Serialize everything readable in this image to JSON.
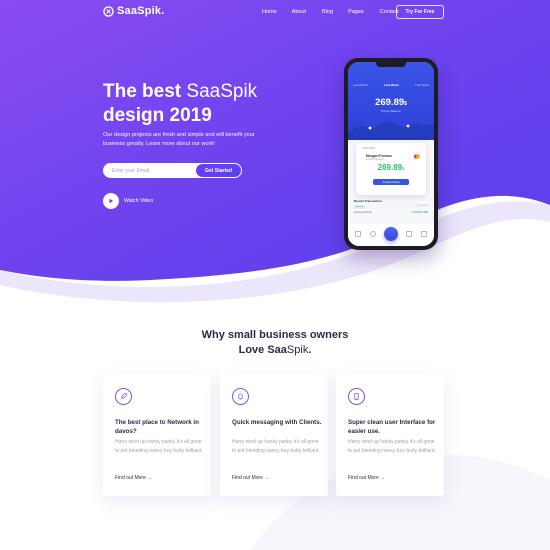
{
  "brand": {
    "logo_text": "SaaSpik.",
    "accent": "#6a3df0"
  },
  "nav": {
    "links": [
      "Home",
      "About",
      "Blog",
      "Pages",
      "Contact"
    ],
    "cta": "Try For Free"
  },
  "hero": {
    "headline_bold_1": "The best",
    "headline_light": " SaaSpik",
    "headline_bold_2": "design 2019",
    "subtext": "Our design projects are fresh and simple and will benefit your business greatly. Learn more about our work!",
    "email_placeholder": "Enter your Email",
    "cta": "Get Started",
    "watch_label": "Watch Video"
  },
  "phone": {
    "tabs": [
      "Last Month",
      "Last Week",
      "This Week"
    ],
    "amount": "269.89",
    "currency": "$",
    "amount_sub": "Payout Balance",
    "card": {
      "date": "24.03.2019",
      "name": "Morgan Freeman",
      "email": "[email protected]",
      "amount": "269.89",
      "currency": "$",
      "button": "Accept Invoice"
    },
    "recent_title": "Recent Transaction",
    "transaction": {
      "badge": "Success",
      "date": "24.03.2019",
      "email": "[email protected]",
      "amount": "+ $ 67.65 USD"
    }
  },
  "section": {
    "title_line1": "Why small business owners",
    "title_line2_bold": "Love Saa",
    "title_line2_light": "Spik",
    "title_line2_end": "."
  },
  "features": [
    {
      "icon": "rocket-icon",
      "title": "The best place to Network in davos?",
      "body": "Harry wind up hanky panky it's all gone to pot bleeding nancy boy butty brilliant.",
      "link": "Find out More →"
    },
    {
      "icon": "bell-icon",
      "title": "Quick messaging with Clients.",
      "body": "Harry wind up hanky panky it's all gone to pot bleeding nancy boy butty brilliant.",
      "link": "Find out More →"
    },
    {
      "icon": "phone-icon",
      "title": "Super clean user Interface for easier use.",
      "body": "Harry wind up hanky panky it's all gone to pot bleeding nancy boy butty brilliant.",
      "link": "Find out More →"
    }
  ]
}
